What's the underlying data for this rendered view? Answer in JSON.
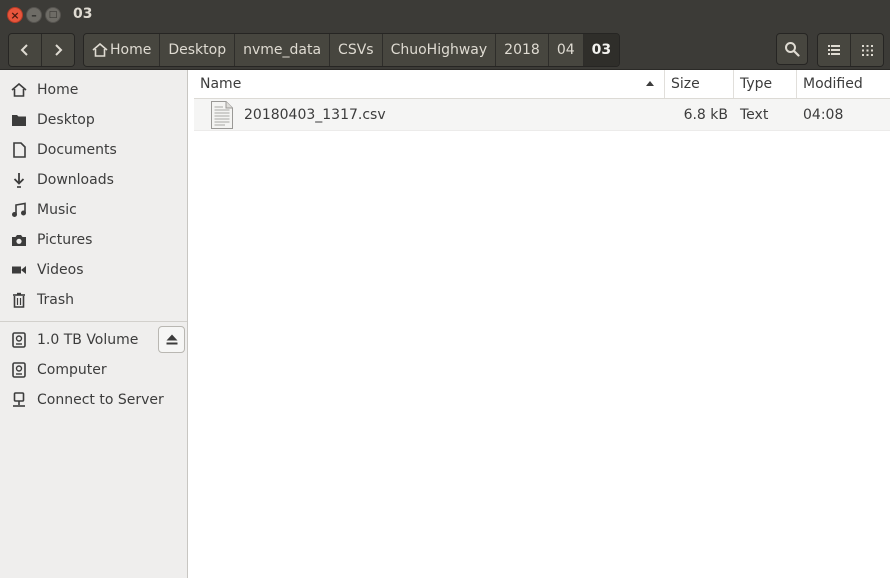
{
  "window": {
    "title": "03",
    "close_glyph": "×",
    "minimize_glyph": "–",
    "maximize_glyph": "□"
  },
  "toolbar": {
    "back_icon": "chevron-left-icon",
    "forward_icon": "chevron-right-icon",
    "breadcrumbs": [
      {
        "label": "Home",
        "icon": "home-icon"
      },
      {
        "label": "Desktop"
      },
      {
        "label": "nvme_data"
      },
      {
        "label": "CSVs"
      },
      {
        "label": "ChuoHighway"
      },
      {
        "label": "2018"
      },
      {
        "label": "04"
      },
      {
        "label": "03",
        "active": true
      }
    ],
    "search_icon": "search-icon",
    "list_view_icon": "list-view-icon",
    "grid_view_icon": "grid-view-icon"
  },
  "sidebar": {
    "places": [
      {
        "label": "Home",
        "icon": "home-icon"
      },
      {
        "label": "Desktop",
        "icon": "folder-icon"
      },
      {
        "label": "Documents",
        "icon": "document-icon"
      },
      {
        "label": "Downloads",
        "icon": "download-icon"
      },
      {
        "label": "Music",
        "icon": "music-icon"
      },
      {
        "label": "Pictures",
        "icon": "camera-icon"
      },
      {
        "label": "Videos",
        "icon": "video-icon"
      },
      {
        "label": "Trash",
        "icon": "trash-icon"
      }
    ],
    "devices": [
      {
        "label": "1.0 TB Volume",
        "icon": "drive-icon",
        "eject": true
      },
      {
        "label": "Computer",
        "icon": "drive-icon"
      },
      {
        "label": "Connect to Server",
        "icon": "network-icon"
      }
    ],
    "eject_icon": "eject-icon"
  },
  "files": {
    "columns": {
      "name": "Name",
      "size": "Size",
      "type": "Type",
      "modified": "Modified"
    },
    "sort": {
      "column": "name",
      "direction": "ascending"
    },
    "rows": [
      {
        "name": "20180403_1317.csv",
        "size": "6.8 kB",
        "type": "Text",
        "modified": "04:08",
        "icon": "text-file-icon"
      }
    ]
  },
  "colors": {
    "titlebar": "#3c3b37",
    "sidebar": "#efeeed",
    "close_button": "#e7553c",
    "row_highlight": "#f5f5f4"
  }
}
